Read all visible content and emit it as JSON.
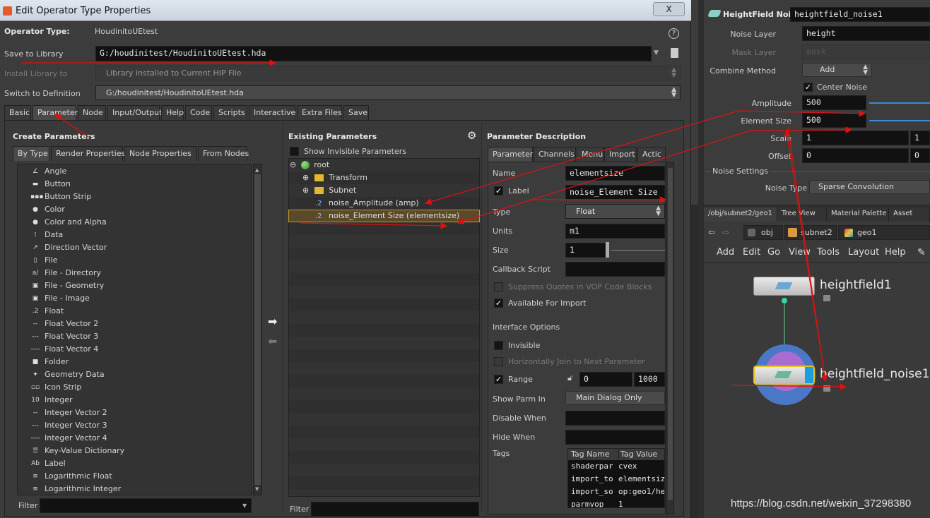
{
  "dialog": {
    "title": "Edit Operator Type Properties",
    "close": "X",
    "operator_type_label": "Operator Type:",
    "operator_type_value": "HoudinitoUEtest",
    "help_icon": "?",
    "save_to_library_label": "Save to Library",
    "save_to_library_value": "G:/houdinitest/HoudinitoUEtest.hda",
    "install_library_label": "Install Library to",
    "install_library_value": "Library installed to Current HIP File",
    "switch_definition_label": "Switch to Definition",
    "switch_definition_value": "G:/houdinitest/HoudinitoUEtest.hda",
    "tabs": [
      "Basic",
      "Parameters",
      "Node",
      "Input/Output",
      "Help",
      "Code",
      "Scripts",
      "Interactive",
      "Extra Files",
      "Save"
    ]
  },
  "create_parameters": {
    "title": "Create Parameters",
    "subtabs": [
      "By Type",
      "Render Properties",
      "Node Properties",
      "From Nodes"
    ],
    "items": [
      {
        "label": "Angle",
        "icon": "angle-icon",
        "glyph": "∠"
      },
      {
        "label": "Button",
        "icon": "button-icon",
        "glyph": "▬"
      },
      {
        "label": "Button Strip",
        "icon": "button-strip-icon",
        "glyph": "▪▪▪"
      },
      {
        "label": "Color",
        "icon": "color-icon",
        "glyph": "●"
      },
      {
        "label": "Color and Alpha",
        "icon": "color-alpha-icon",
        "glyph": "●"
      },
      {
        "label": "Data",
        "icon": "data-icon",
        "glyph": "⁞"
      },
      {
        "label": "Direction Vector",
        "icon": "direction-vector-icon",
        "glyph": "↗"
      },
      {
        "label": "File",
        "icon": "file-icon",
        "glyph": "▯"
      },
      {
        "label": "File - Directory",
        "icon": "file-directory-icon",
        "glyph": "a/"
      },
      {
        "label": "File - Geometry",
        "icon": "file-geometry-icon",
        "glyph": "▣"
      },
      {
        "label": "File - Image",
        "icon": "file-image-icon",
        "glyph": "▣"
      },
      {
        "label": "Float",
        "icon": "float-icon",
        "glyph": ".2"
      },
      {
        "label": "Float Vector 2",
        "icon": "float-vector2-icon",
        "glyph": "--"
      },
      {
        "label": "Float Vector 3",
        "icon": "float-vector3-icon",
        "glyph": "---"
      },
      {
        "label": "Float Vector 4",
        "icon": "float-vector4-icon",
        "glyph": "----"
      },
      {
        "label": "Folder",
        "icon": "folder-icon",
        "glyph": "■"
      },
      {
        "label": "Geometry Data",
        "icon": "geometry-data-icon",
        "glyph": "✦"
      },
      {
        "label": "Icon Strip",
        "icon": "icon-strip-icon",
        "glyph": "▫▫"
      },
      {
        "label": "Integer",
        "icon": "integer-icon",
        "glyph": "10"
      },
      {
        "label": "Integer Vector 2",
        "icon": "integer-vector2-icon",
        "glyph": "--"
      },
      {
        "label": "Integer Vector 3",
        "icon": "integer-vector3-icon",
        "glyph": "---"
      },
      {
        "label": "Integer Vector 4",
        "icon": "integer-vector4-icon",
        "glyph": "----"
      },
      {
        "label": "Key-Value Dictionary",
        "icon": "dictionary-icon",
        "glyph": "☰"
      },
      {
        "label": "Label",
        "icon": "label-icon",
        "glyph": "Ab"
      },
      {
        "label": "Logarithmic Float",
        "icon": "log-float-icon",
        "glyph": "≡"
      },
      {
        "label": "Logarithmic Integer",
        "icon": "log-integer-icon",
        "glyph": "≡"
      }
    ],
    "filter_label": "Filter"
  },
  "existing_parameters": {
    "title": "Existing Parameters",
    "show_invisible_label": "Show Invisible Parameters",
    "tree": {
      "root": "root",
      "transform": "Transform",
      "subnet": "Subnet",
      "amp": "noise_Amplitude (amp)",
      "elementsize": "noise_Element Size (elementsize)"
    },
    "filter_label": "Filter"
  },
  "param_description": {
    "title": "Parameter Description",
    "tabs": [
      "Parameter",
      "Channels",
      "Menu",
      "Import",
      "Actic"
    ],
    "name_label": "Name",
    "name_value": "elementsize",
    "label_label": "Label",
    "label_value": "noise_Element Size",
    "type_label": "Type",
    "type_value": "Float",
    "units_label": "Units",
    "units_value": "m1",
    "size_label": "Size",
    "size_value": "1",
    "callback_label": "Callback Script",
    "suppress_quotes": "Suppress Quotes in VOP Code Blocks",
    "available_import": "Available For Import",
    "interface_options": "Interface Options",
    "invisible": "Invisible",
    "horiz_join": "Horizontally Join to Next Parameter",
    "range_label": "Range",
    "range_min": "0",
    "range_max": "1000",
    "show_parm_label": "Show Parm In",
    "show_parm_value": "Main Dialog Only",
    "disable_when": "Disable When",
    "hide_when": "Hide When",
    "tags_label": "Tags",
    "tag_headers": [
      "Tag Name",
      "Tag Value"
    ],
    "tag_rows": [
      [
        "shaderpar",
        "cvex"
      ],
      [
        "import_to",
        "elementsiz"
      ],
      [
        "import_so",
        "op:geo1/he"
      ],
      [
        "parmvop",
        "1"
      ]
    ]
  },
  "hf_params": {
    "node_type": "HeightField Noise",
    "node_name": "heightfield_noise1",
    "noise_layer_label": "Noise Layer",
    "noise_layer_value": "height",
    "mask_layer_label": "Mask Layer",
    "mask_layer_value": "mask",
    "combine_label": "Combine Method",
    "combine_value": "Add",
    "center_noise": "Center Noise",
    "amplitude_label": "Amplitude",
    "amplitude_value": "500",
    "element_size_label": "Element Size",
    "element_size_value": "500",
    "scale_label": "Scale",
    "scale_value": "1",
    "scale_value2": "1",
    "offset_label": "Offset",
    "offset_value": "0",
    "offset_value2": "0",
    "noise_settings": "Noise Settings",
    "noise_type_label": "Noise Type",
    "noise_type_value": "Sparse Convolution"
  },
  "network": {
    "tabs": [
      "/obj/subnet2/geo1",
      "Tree View",
      "Material Palette",
      "Asset"
    ],
    "path": [
      "obj",
      "subnet2",
      "geo1"
    ],
    "menu": [
      "Add",
      "Edit",
      "Go",
      "View",
      "Tools",
      "Layout",
      "Help"
    ],
    "node1": "heightfield1",
    "node2": "heightfield_noise1",
    "watermark": "https://blog.csdn.net/weixin_37298380"
  }
}
